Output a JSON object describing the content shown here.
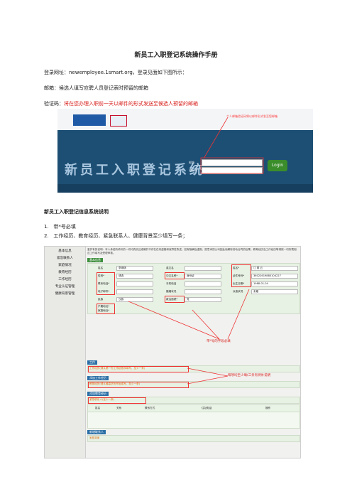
{
  "doc": {
    "title": "新员工入职登记系统操作手册",
    "login_url_line": "登录网址：newemployee.1smart.org，登录见面如下图所示：",
    "email_line": "邮箱：候选人填写应聘人员登记表时预留的邮箱",
    "code_prefix": "验证码：",
    "code_text": "将在您办理入职前一天以邮件的形式发送至候选人预留的邮箱",
    "section_heading": "新员工入职登记信息系统说明",
    "item1_num": "1.",
    "item1": "带*号必填",
    "item2_num": "2.",
    "item2": "工作经历、教育经历、紧急联系人、健康背景至少填写一条；"
  },
  "login_screen": {
    "system_title": "新员工入职登记系统",
    "email_label": "邮箱",
    "code_label": "验证码",
    "login_button": "Login",
    "note": "个人邮箱验证码将以邮件形式发至您邮箱"
  },
  "form_screen": {
    "sidebar": [
      "基本信息",
      "紧急联系人",
      "家庭情况",
      "教育经历",
      "工作经历",
      "专业认证管理",
      "健康背景管理"
    ],
    "tip": "爱护有的说明：本人承诺所填写的一切均真实且准确并不存在任何虚假和误导性陈述，如有隐瞒及虚报，愿意承担公司因此而解除劳动合同的后果。教育经历及工作经历等请按一切所载相应工作填写及受理审核。",
    "basic_section": "基本信息",
    "fields": {
      "name_label": "姓名",
      "name_value": "李琪琪",
      "english_label": "英文名",
      "gender_label": "性别*",
      "gender_value": "请选",
      "nation_label": "中文名称*",
      "nation_value": "身份证",
      "phone_label": "联系电话*",
      "mobile_label": "手机电话",
      "email_label": "电子邮件*",
      "marital_label": "婚姻状况",
      "nation2_label": "民族",
      "nation2_value": "汉族",
      "politic_label": "政治面貌*",
      "politic_value": "党",
      "hukou_label": "户籍地址*",
      "home_label": "家庭地址*",
      "idno_label": "证件号码*",
      "idno_value": "36022619880104227",
      "birth_label": "出生日期*",
      "birth_value": "1988-01-04",
      "dispatch_label": "派遣状况",
      "dispatch_value": "未婚",
      "surname_label": "姓名*",
      "surname_value": "江 丽 云"
    },
    "work_section": "工作",
    "work_hint": "工作经历(请从第一份工作起依序填写，至少一条)",
    "edu_add": "添加工作经历",
    "edu_hint": "教育经历(请从最高学历开始填写，至少一条)",
    "edu_add2": "添加教育经历",
    "emergency_hint": "紧急联系人(至少一条)",
    "table_headers": [
      "姓名",
      "关系",
      "联系方式",
      "住址电话",
      "操作"
    ],
    "family_add": "新增联系人",
    "family_section": "家庭背景",
    "annotation_required": "带*号的字段必填",
    "annotation_atleast": "每项均至少填(三条有待补说明"
  },
  "colors": {
    "red": "#d8201c",
    "login_bg": "#1d4f74",
    "section_green": "#3e8f3e"
  }
}
